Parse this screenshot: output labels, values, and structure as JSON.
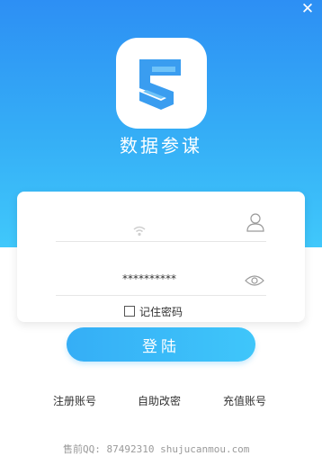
{
  "app": {
    "title": "数据参谋",
    "close_glyph": "✕"
  },
  "login_form": {
    "username": {
      "value": "",
      "icon": "user-icon"
    },
    "password": {
      "value": "**********",
      "icon": "eye-icon"
    },
    "remember_label": "记住密码",
    "remember_checked": false,
    "login_label": "登陆"
  },
  "links": {
    "register": "注册账号",
    "self_service": "自助改密",
    "recharge": "充值账号"
  },
  "footer": {
    "text": "售前QQ: 87492310 shujucanmou.com"
  },
  "colors": {
    "header_gradient_top": "#2d8ff4",
    "header_gradient_bottom": "#40c8fb",
    "button": "#3fc6fa"
  }
}
